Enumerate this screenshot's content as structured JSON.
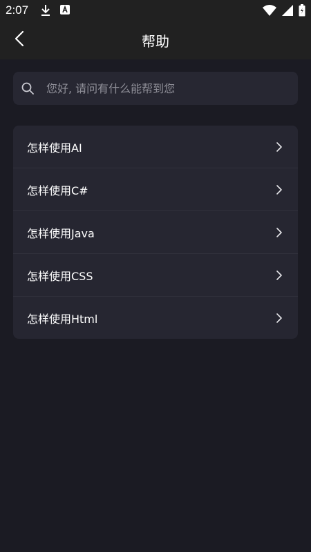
{
  "status_bar": {
    "time": "2:07",
    "icons": [
      "download-icon",
      "a-badge-icon",
      "wifi-icon",
      "signal-icon",
      "battery-icon"
    ]
  },
  "header": {
    "title": "帮助",
    "back_icon": "chevron-left-icon"
  },
  "search": {
    "placeholder": "您好, 请问有什么能帮到您",
    "value": "",
    "icon": "search-icon"
  },
  "help_items": [
    {
      "label": "怎样使用AI"
    },
    {
      "label": "怎样使用C#"
    },
    {
      "label": "怎样使用Java"
    },
    {
      "label": "怎样使用CSS"
    },
    {
      "label": "怎样使用Html"
    }
  ],
  "colors": {
    "background": "#1b1b23",
    "bar": "#212121",
    "card": "#262631",
    "placeholder": "#8f8f98"
  }
}
